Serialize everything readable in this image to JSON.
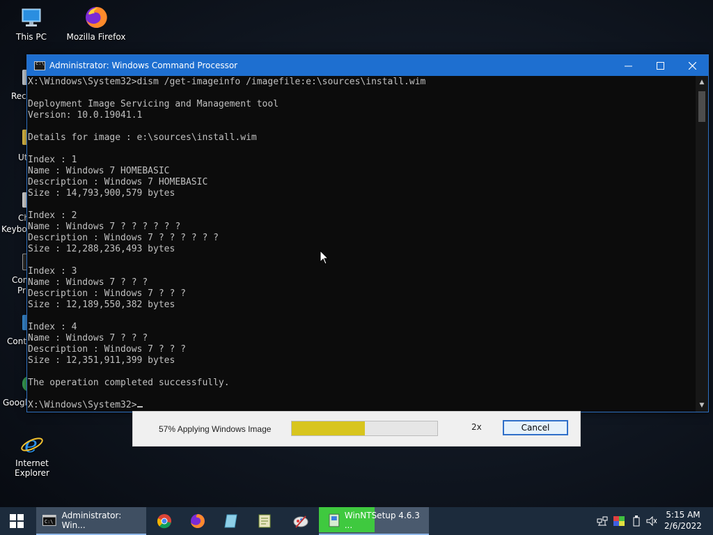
{
  "desktop": {
    "icons": [
      {
        "label": "This PC",
        "icon": "computer-icon"
      },
      {
        "label": "Mozilla Firefox",
        "icon": "firefox-icon"
      },
      {
        "label": "Internet Explorer",
        "icon": "internet-explorer-icon"
      }
    ],
    "partial_labels": [
      "Recy",
      "Ut",
      "Ch",
      "Keybo",
      "Con",
      "Pr",
      "Contr",
      "Googl"
    ]
  },
  "cmd_window": {
    "title": "Administrator: Windows Command Processor",
    "controls": {
      "minimize": "minimize-icon",
      "maximize": "maximize-icon",
      "close": "close-icon"
    },
    "lines": [
      "X:\\Windows\\System32>dism /get-imageinfo /imagefile:e:\\sources\\install.wim",
      "",
      "Deployment Image Servicing and Management tool",
      "Version: 10.0.19041.1",
      "",
      "Details for image : e:\\sources\\install.wim",
      "",
      "Index : 1",
      "Name : Windows 7 HOMEBASIC",
      "Description : Windows 7 HOMEBASIC",
      "Size : 14,793,900,579 bytes",
      "",
      "Index : 2",
      "Name : Windows 7 ? ? ? ? ? ?",
      "Description : Windows 7 ? ? ? ? ? ?",
      "Size : 12,288,236,493 bytes",
      "",
      "Index : 3",
      "Name : Windows 7 ? ? ?",
      "Description : Windows 7 ? ? ?",
      "Size : 12,189,550,382 bytes",
      "",
      "Index : 4",
      "Name : Windows 7 ? ? ?",
      "Description : Windows 7 ? ? ?",
      "Size : 12,351,911,399 bytes",
      "",
      "The operation completed successfully.",
      ""
    ],
    "prompt": "X:\\Windows\\System32>"
  },
  "progress_dialog": {
    "status_text": "57% Applying Windows Image",
    "progress": 0.5,
    "speed": "2x",
    "cancel_label": "Cancel",
    "fill_color": "#d8c51e"
  },
  "taskbar": {
    "start": "windows-logo-icon",
    "items": [
      {
        "label": "Administrator: Win...",
        "icon": "cmd-icon"
      },
      {
        "label": "WinNTSetup 4.6.3   ...",
        "icon": "winntsetup-icon"
      }
    ],
    "pinned": [
      "chrome-icon",
      "firefox-icon",
      "notepad-icon",
      "editor-icon",
      "paint-icon"
    ],
    "tray": [
      "network-icon",
      "display-icon",
      "battery-icon",
      "usb-icon",
      "volume-muted-icon"
    ],
    "time": "5:15 AM",
    "date": "2/6/2022"
  }
}
